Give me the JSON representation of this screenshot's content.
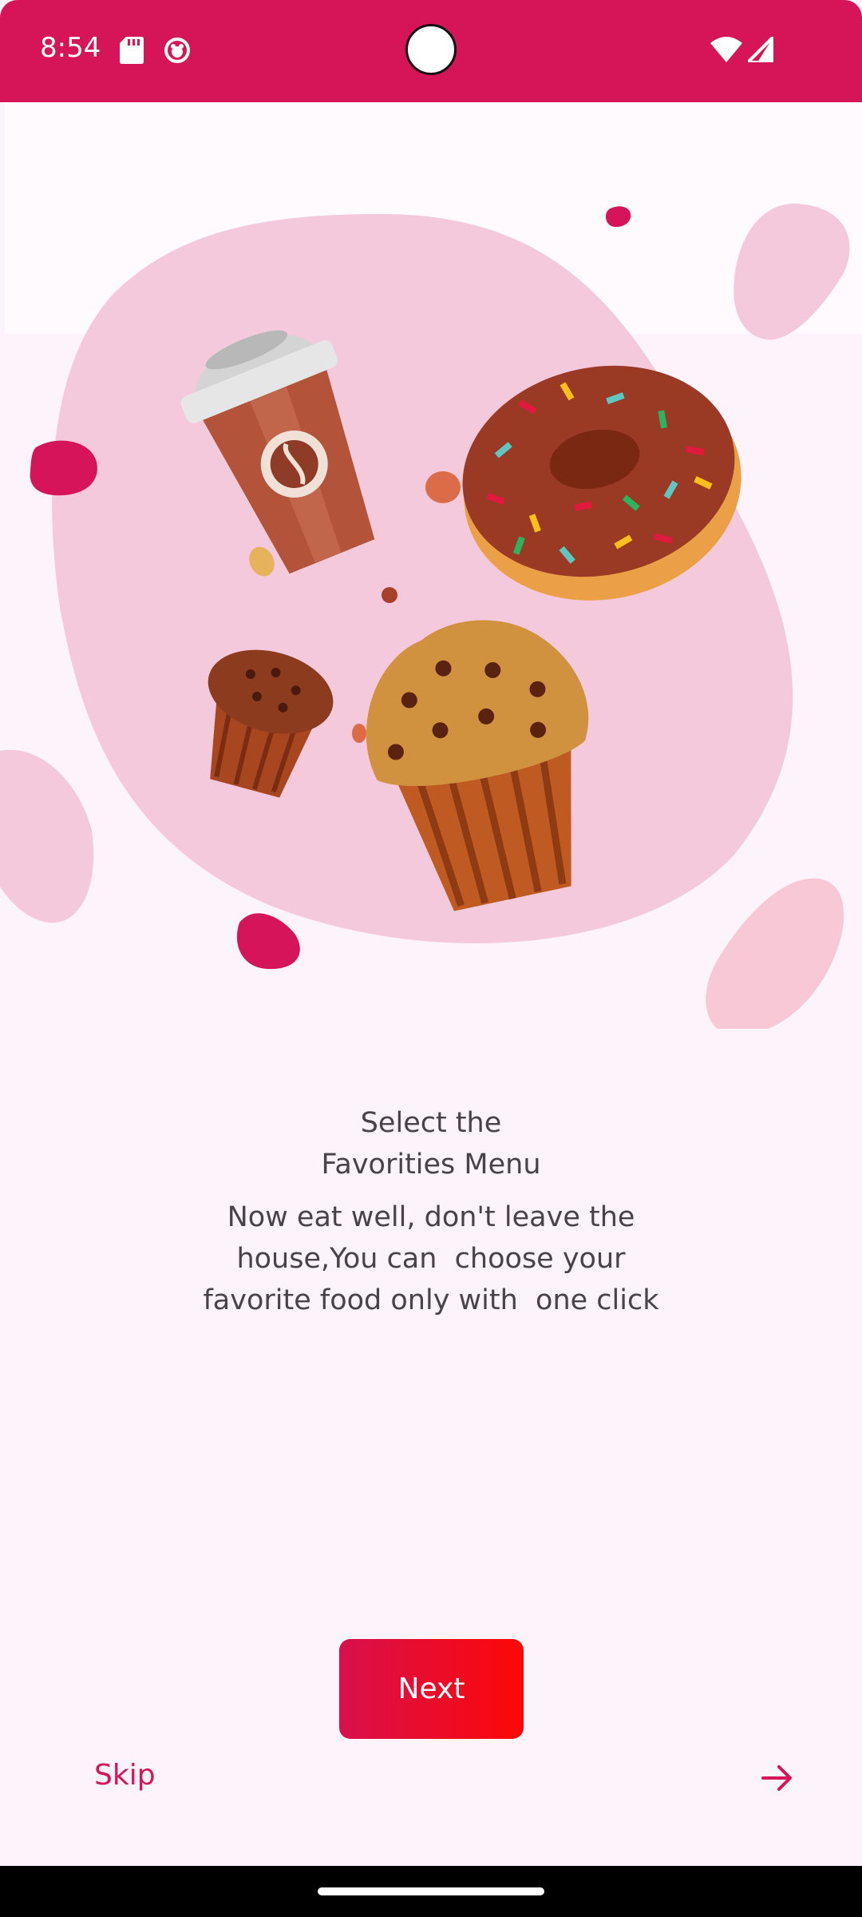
{
  "status_bar": {
    "time": "8:54",
    "background_color": "#d61458",
    "icons": [
      "sd-card-icon",
      "notification-app-icon",
      "wifi-icon",
      "cellular-signal-icon"
    ]
  },
  "onboarding": {
    "title_lines": [
      "Select the",
      "Favorities Menu"
    ],
    "description_lines": [
      "Now eat well, don't leave the",
      "house,You can  choose your",
      "favorite food only with  one click"
    ],
    "illustration_items": [
      "coffee-cup",
      "donut",
      "small-muffin",
      "large-muffin"
    ]
  },
  "actions": {
    "next_label": "Next",
    "skip_label": "Skip",
    "forward_icon": "arrow-right-icon"
  },
  "colors": {
    "accent": "#d61458",
    "button_gradient_start": "#d8104e",
    "button_gradient_end": "#fc0808",
    "background": "#fcf3fb",
    "blob": "#f5c9dc",
    "text": "#4b4248"
  }
}
